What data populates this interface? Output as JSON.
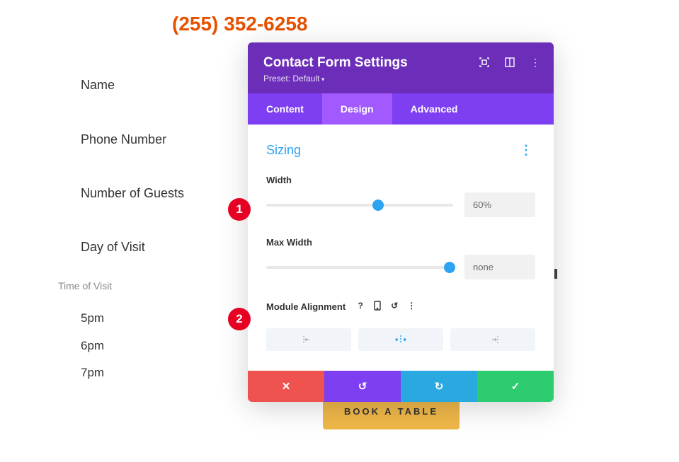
{
  "phone": "(255) 352-6258",
  "bg_fields": {
    "name": "Name",
    "phone": "Phone Number",
    "guests": "Number of Guests",
    "day": "Day of Visit",
    "time_label": "Time of Visit",
    "times": [
      "5pm",
      "6pm",
      "7pm"
    ]
  },
  "markers": {
    "m1": "1",
    "m2": "2"
  },
  "panel": {
    "title": "Contact Form Settings",
    "preset": "Preset: Default",
    "tabs": {
      "content": "Content",
      "design": "Design",
      "advanced": "Advanced"
    },
    "section_title": "Sizing",
    "width": {
      "label": "Width",
      "value": "60%",
      "percent": 60
    },
    "max_width": {
      "label": "Max Width",
      "value": "none",
      "percent": 100
    },
    "align": {
      "label": "Module Alignment"
    }
  },
  "cta": "BOOK A TABLE"
}
